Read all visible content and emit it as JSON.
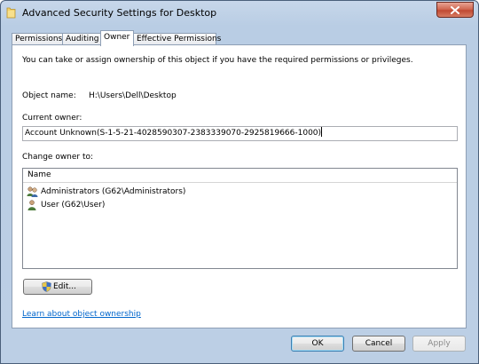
{
  "window": {
    "title": "Advanced Security Settings for Desktop"
  },
  "tabs": [
    {
      "label": "Permissions",
      "active": false
    },
    {
      "label": "Auditing",
      "active": false
    },
    {
      "label": "Owner",
      "active": true
    },
    {
      "label": "Effective Permissions",
      "active": false
    }
  ],
  "owner_page": {
    "description": "You can take or assign ownership of this object if you have the required permissions or privileges.",
    "object_name_label": "Object name:",
    "object_name_value": "H:\\Users\\Dell\\Desktop",
    "current_owner_label": "Current owner:",
    "current_owner_value": "Account Unknown(S-1-5-21-4028590307-2383339070-2925819666-1000)",
    "change_owner_label": "Change owner to:",
    "list_header": "Name",
    "owners": [
      {
        "label": "Administrators (G62\\Administrators)",
        "icon": "group-users-icon"
      },
      {
        "label": "User (G62\\User)",
        "icon": "user-icon"
      }
    ],
    "edit_button_label": "Edit...",
    "learn_link": "Learn about object ownership"
  },
  "footer": {
    "ok_label": "OK",
    "cancel_label": "Cancel",
    "apply_label": "Apply",
    "apply_enabled": false
  }
}
